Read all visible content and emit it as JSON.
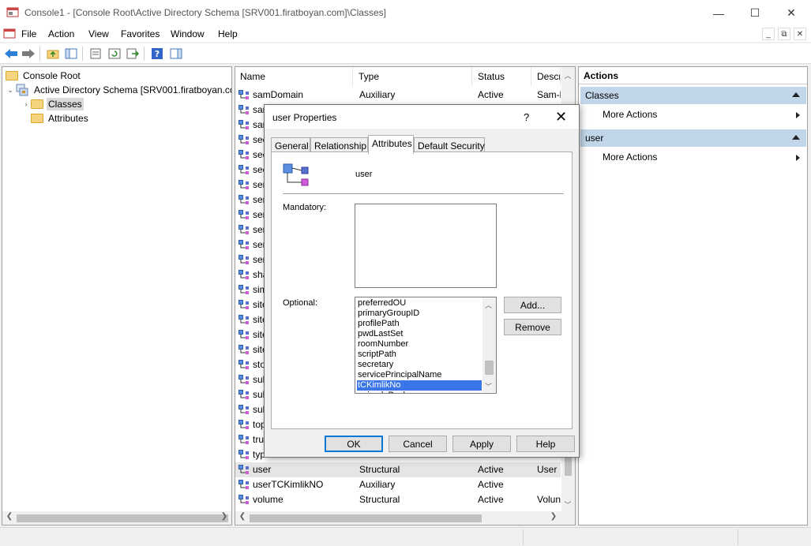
{
  "window": {
    "title": "Console1 - [Console Root\\Active Directory Schema [SRV001.firatboyan.com]\\Classes]",
    "minimize_glyph": "—",
    "maximize_glyph": "☐",
    "close_glyph": "✕"
  },
  "menu": {
    "items": [
      "File",
      "Action",
      "View",
      "Favorites",
      "Window",
      "Help"
    ],
    "mdi": [
      "_",
      "⧉",
      "✕"
    ]
  },
  "tree": {
    "items": [
      {
        "label": "Console Root"
      },
      {
        "label": "Active Directory Schema [SRV001.firatboyan.cc"
      },
      {
        "label": "Classes"
      },
      {
        "label": "Attributes"
      }
    ]
  },
  "list": {
    "columns": [
      "Name",
      "Type",
      "Status",
      "Descr"
    ],
    "rows": [
      {
        "name": "samDomain",
        "type": "Auxiliary",
        "status": "Active",
        "desc": "Sam-l"
      },
      {
        "name": "sar",
        "type": "",
        "status": "",
        "desc": ""
      },
      {
        "name": "sar",
        "type": "",
        "status": "",
        "desc": ""
      },
      {
        "name": "sec",
        "type": "",
        "status": "",
        "desc": ""
      },
      {
        "name": "sec",
        "type": "",
        "status": "",
        "desc": ""
      },
      {
        "name": "sec",
        "type": "",
        "status": "",
        "desc": ""
      },
      {
        "name": "ser",
        "type": "",
        "status": "",
        "desc": ""
      },
      {
        "name": "ser",
        "type": "",
        "status": "",
        "desc": ""
      },
      {
        "name": "ser",
        "type": "",
        "status": "",
        "desc": ""
      },
      {
        "name": "ser",
        "type": "",
        "status": "",
        "desc": ""
      },
      {
        "name": "ser",
        "type": "",
        "status": "",
        "desc": ""
      },
      {
        "name": "ser",
        "type": "",
        "status": "",
        "desc": ""
      },
      {
        "name": "sha",
        "type": "",
        "status": "",
        "desc": ""
      },
      {
        "name": "sim",
        "type": "",
        "status": "",
        "desc": ""
      },
      {
        "name": "site",
        "type": "",
        "status": "",
        "desc": ""
      },
      {
        "name": "site",
        "type": "",
        "status": "",
        "desc": ""
      },
      {
        "name": "site",
        "type": "",
        "status": "",
        "desc": ""
      },
      {
        "name": "site",
        "type": "",
        "status": "",
        "desc": ""
      },
      {
        "name": "sto",
        "type": "",
        "status": "",
        "desc": ""
      },
      {
        "name": "sub",
        "type": "",
        "status": "",
        "desc": ""
      },
      {
        "name": "sub",
        "type": "",
        "status": "",
        "desc": ""
      },
      {
        "name": "sub",
        "type": "",
        "status": "",
        "desc": ""
      },
      {
        "name": "top",
        "type": "",
        "status": "",
        "desc": ""
      },
      {
        "name": "tru",
        "type": "",
        "status": "",
        "desc": ""
      },
      {
        "name": "typ",
        "type": "",
        "status": "",
        "desc": ""
      },
      {
        "name": "user",
        "type": "Structural",
        "status": "Active",
        "desc": "User"
      },
      {
        "name": "userTCKimlikNO",
        "type": "Auxiliary",
        "status": "Active",
        "desc": ""
      },
      {
        "name": "volume",
        "type": "Structural",
        "status": "Active",
        "desc": "Volun"
      }
    ]
  },
  "actions": {
    "header": "Actions",
    "sections": [
      {
        "title": "Classes",
        "item": "More Actions"
      },
      {
        "title": "user",
        "item": "More Actions"
      }
    ]
  },
  "dialog": {
    "title": "user Properties",
    "help_glyph": "?",
    "close_glyph": "✕",
    "tabs": [
      "General",
      "Relationship",
      "Attributes",
      "Default Security"
    ],
    "active_tab": "Attributes",
    "class_name": "user",
    "mandatory_label": "Mandatory:",
    "optional_label": "Optional:",
    "optional_items": [
      "preferredOU",
      "primaryGroupID",
      "profilePath",
      "pwdLastSet",
      "roomNumber",
      "scriptPath",
      "secretary",
      "servicePrincipalName",
      "tCKimlikNo",
      "unicodePwd"
    ],
    "selected_optional": "tCKimlikNo",
    "add_button": "Add...",
    "remove_button": "Remove",
    "ok_button": "OK",
    "cancel_button": "Cancel",
    "apply_button": "Apply",
    "help_button": "Help"
  },
  "colors": {
    "selection_blue": "#3b76e9",
    "action_section_bg": "#c2d6ea",
    "default_button_border": "#0078d7"
  }
}
